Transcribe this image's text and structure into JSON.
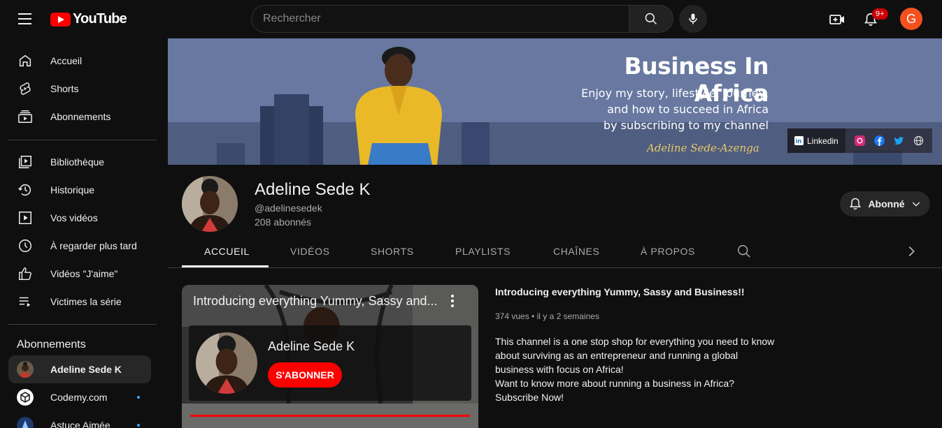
{
  "topbar": {
    "logo_text": "YouTube",
    "search_placeholder": "Rechercher",
    "notification_count": "9+",
    "account_initial": "G"
  },
  "sidebar": {
    "main": [
      {
        "label": "Accueil",
        "icon": "home-icon"
      },
      {
        "label": "Shorts",
        "icon": "shorts-icon"
      },
      {
        "label": "Abonnements",
        "icon": "subscriptions-icon"
      }
    ],
    "library": [
      {
        "label": "Bibliothèque",
        "icon": "library-icon"
      },
      {
        "label": "Historique",
        "icon": "history-icon"
      },
      {
        "label": "Vos vidéos",
        "icon": "your-videos-icon"
      },
      {
        "label": "À regarder plus tard",
        "icon": "watch-later-icon"
      },
      {
        "label": "Vidéos \"J'aime\"",
        "icon": "liked-icon"
      },
      {
        "label": "Victimes la série",
        "icon": "playlist-icon"
      }
    ],
    "subscriptions_title": "Abonnements",
    "subscriptions": [
      {
        "label": "Adeline Sede K",
        "active": true,
        "new": false
      },
      {
        "label": "Codemy.com",
        "active": false,
        "new": true
      },
      {
        "label": "Astuce Aimée",
        "active": false,
        "new": true
      }
    ]
  },
  "banner": {
    "title": "Business In Africa",
    "subtitle_lines": [
      "Enjoy my story, lifestyle, journey,",
      "and how to succeed in Africa",
      "by subscribing to my channel"
    ],
    "signature": "Adeline Sede-Azenga",
    "link_label": "Linkedin",
    "colors": {
      "instagram": "#d62976",
      "facebook": "#1877f2",
      "twitter": "#1da1f2"
    }
  },
  "channel": {
    "name": "Adeline Sede K",
    "handle": "@adelinesedek",
    "subscribers": "208 abonnés",
    "subscribe_state": "Abonné"
  },
  "tabs": [
    "ACCUEIL",
    "VIDÉOS",
    "SHORTS",
    "PLAYLISTS",
    "CHAÎNES",
    "À PROPOS"
  ],
  "featured": {
    "player_title": "Introducing everything Yummy, Sassy and...",
    "endcard_name": "Adeline Sede K",
    "endcard_subscribe": "S'ABONNER",
    "title": "Introducing everything Yummy, Sassy and Business!!",
    "meta": "374 vues • il y a 2 semaines",
    "description": [
      "This channel is a one stop shop for everything you need to know",
      "about surviving as an entrepreneur and running a global",
      "business with focus on Africa!",
      "Want to know more about running a business in Africa?",
      "Subscribe Now!"
    ]
  }
}
